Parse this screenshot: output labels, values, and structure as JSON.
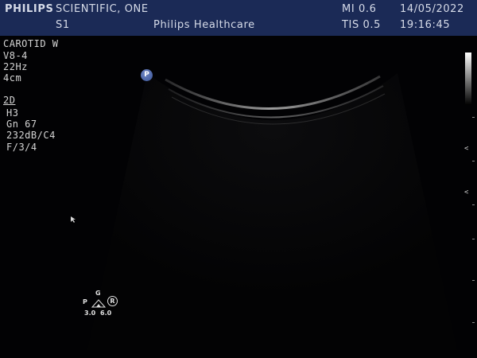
{
  "header": {
    "brand": "PHILIPS",
    "patient_name": "SCIENTIFIC, ONE",
    "probe_slot": "S1",
    "institution": "Philips Healthcare",
    "mi": "MI 0.6",
    "tis": "TIS 0.5",
    "date": "14/05/2022",
    "time": "19:16:45"
  },
  "imaging_params": {
    "preset": "CAROTID W",
    "transducer": "V8-4",
    "frame_rate": "22Hz",
    "depth": "4cm",
    "mode": "2D",
    "harmonic": "H3",
    "gain": "Gn 67",
    "dynamic_range": "232dB/C4",
    "persistence": "F/3/4"
  },
  "orientation_marker": "P",
  "focus_markers": [
    "<",
    "<"
  ],
  "navigator": {
    "top_label": "G",
    "left_label": "P",
    "right_label": "R",
    "value_left": "3.0",
    "value_right": "6.0"
  },
  "colors": {
    "header_bg": "#1b2a56",
    "header_text": "#d6dbe8",
    "overlay_text": "#d4d4d4",
    "marker_blue": "#4a63a8"
  }
}
